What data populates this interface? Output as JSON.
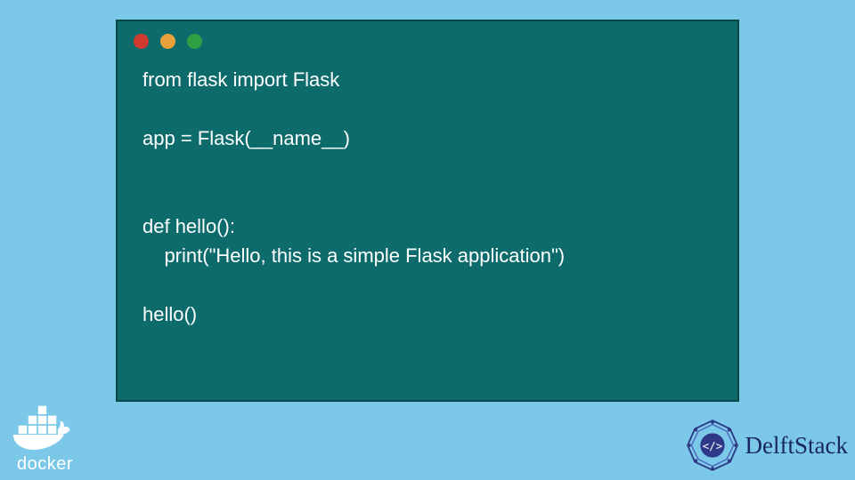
{
  "code": {
    "line1": "from flask import Flask",
    "line2": "",
    "line3": "app = Flask(__name__)",
    "line4": "",
    "line5": "",
    "line6": "def hello():",
    "line7": "    print(\"Hello, this is a simple Flask application\")",
    "line8": "",
    "line9": "hello()"
  },
  "logos": {
    "docker_label": "docker",
    "delftstack_label": "DelftStack"
  },
  "colors": {
    "bg": "#7bc8e8",
    "window_bg": "#0d6b6b",
    "dot_red": "#d03a2e",
    "dot_yellow": "#e8a13a",
    "dot_green": "#2ea043"
  }
}
